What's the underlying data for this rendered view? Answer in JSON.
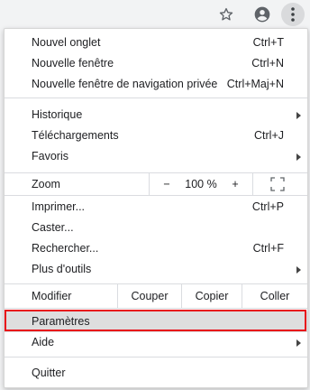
{
  "menu": {
    "new_tab": {
      "label": "Nouvel onglet",
      "shortcut": "Ctrl+T"
    },
    "new_window": {
      "label": "Nouvelle fenêtre",
      "shortcut": "Ctrl+N"
    },
    "incognito": {
      "label": "Nouvelle fenêtre de navigation privée",
      "shortcut": "Ctrl+Maj+N"
    },
    "history": {
      "label": "Historique"
    },
    "downloads": {
      "label": "Téléchargements",
      "shortcut": "Ctrl+J"
    },
    "bookmarks": {
      "label": "Favoris"
    },
    "zoom": {
      "label": "Zoom",
      "minus": "−",
      "value": "100 %",
      "plus": "+"
    },
    "print": {
      "label": "Imprimer...",
      "shortcut": "Ctrl+P"
    },
    "cast": {
      "label": "Caster..."
    },
    "find": {
      "label": "Rechercher...",
      "shortcut": "Ctrl+F"
    },
    "more_tools": {
      "label": "Plus d'outils"
    },
    "edit": {
      "label": "Modifier",
      "cut": "Couper",
      "copy": "Copier",
      "paste": "Coller"
    },
    "settings": {
      "label": "Paramètres"
    },
    "help": {
      "label": "Aide"
    },
    "quit": {
      "label": "Quitter"
    }
  },
  "icons": {
    "star": "star-icon",
    "profile": "account-circle-icon",
    "menu": "three-dots-vertical-icon",
    "fullscreen": "fullscreen-icon",
    "submenu_arrow": "triangle-right-icon"
  },
  "colors": {
    "highlight": "#dedede",
    "annotation_box": "#e8101a",
    "separator": "#dadce0"
  }
}
